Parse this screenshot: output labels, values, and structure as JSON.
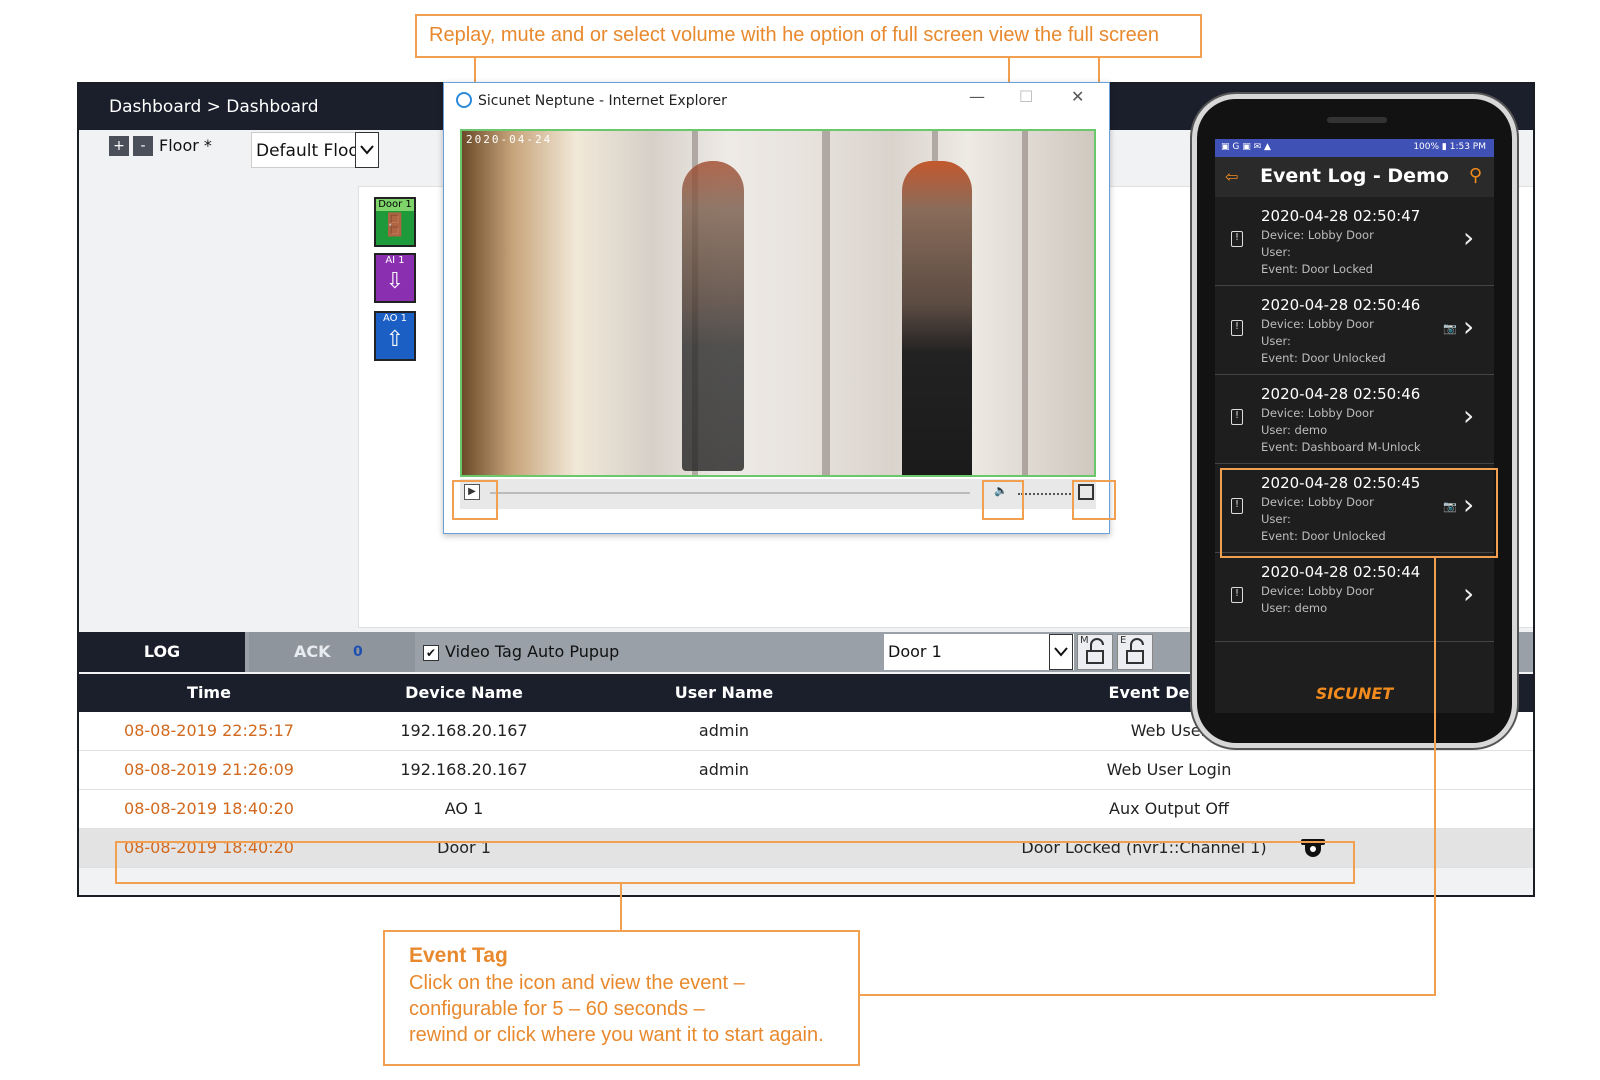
{
  "callouts": {
    "top": "Replay, mute and or select volume with he option of full screen view the full screen",
    "event_tag_title": "Event Tag",
    "event_tag_body_1": "Click on the icon and view the event –",
    "event_tag_body_2": "configurable for 5 – 60 seconds –",
    "event_tag_body_3": "rewind or click where you want it to start again."
  },
  "dashboard": {
    "breadcrumb": "Dashboard > Dashboard",
    "floor_add": "+",
    "floor_remove": "-",
    "floor_label": "Floor *",
    "floor_value": "Default Floor",
    "devices": [
      {
        "label": "Door 1",
        "icon": "door-icon",
        "color": "#1e9a3a"
      },
      {
        "label": "AI 1",
        "icon": "arrow-down-icon",
        "color": "#8a2fb0"
      },
      {
        "label": "AO 1",
        "icon": "arrow-up-icon",
        "color": "#1b5fc4"
      }
    ]
  },
  "tabs": {
    "log": "LOG",
    "ack": "ACK",
    "ack_count": "0",
    "video_tag": "Video Tag Auto Pupup",
    "door_select": "Door 1",
    "icon_m": "M",
    "icon_e": "E"
  },
  "table": {
    "headers": [
      "Time",
      "Device Name",
      "User Name",
      "Event De"
    ],
    "rows": [
      {
        "time": "08-08-2019 22:25:17",
        "device": "192.168.20.167",
        "user": "admin",
        "event": "Web User"
      },
      {
        "time": "08-08-2019 21:26:09",
        "device": "192.168.20.167",
        "user": "admin",
        "event": "Web User Login"
      },
      {
        "time": "08-08-2019 18:40:20",
        "device": "AO 1",
        "user": "",
        "event": "Aux Output Off"
      },
      {
        "time": "08-08-2019 18:40:20",
        "device": "Door 1",
        "user": "",
        "event": "Door Locked (nvr1::Channel 1)"
      }
    ]
  },
  "ie_window": {
    "title": "Sicunet Neptune - Internet Explorer",
    "timestamp": "2020-04-24",
    "minimize": "—",
    "maximize": "☐",
    "close": "✕"
  },
  "phone": {
    "status_left": "▣ G ▣ ✉ ▲",
    "status_right": "100% ▮ 1:53 PM",
    "title": "Event Log - Demo",
    "events": [
      {
        "time": "2020-04-28 02:50:47",
        "device": "Device: Lobby Door",
        "user": "User:",
        "event": "Event: Door Locked",
        "camera": false
      },
      {
        "time": "2020-04-28 02:50:46",
        "device": "Device: Lobby Door",
        "user": "User:",
        "event": "Event: Door Unlocked",
        "camera": true
      },
      {
        "time": "2020-04-28 02:50:46",
        "device": "Device: Lobby Door",
        "user": "User: demo",
        "event": "Event: Dashboard M-Unlock",
        "camera": false
      },
      {
        "time": "2020-04-28 02:50:45",
        "device": "Device: Lobby Door",
        "user": "User:",
        "event": "Event: Door Unlocked",
        "camera": true
      },
      {
        "time": "2020-04-28 02:50:44",
        "device": "Device: Lobby Door",
        "user": "User: demo",
        "event": "",
        "camera": false
      }
    ],
    "brand": "SICUNET"
  },
  "colors": {
    "callout": "#e8892e",
    "accent": "#f28b1e",
    "nav": "#1b1f2b",
    "time_text": "#d2691e"
  }
}
